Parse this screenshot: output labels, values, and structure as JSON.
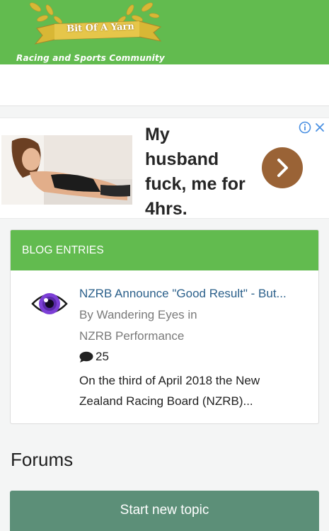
{
  "header": {
    "logo_text": "Bit Of A Yarn",
    "subtitle": "Racing and Sports Community",
    "colors": {
      "brand_green": "#62bb4f",
      "logo_gold": "#d8b735"
    }
  },
  "ad": {
    "headline_lines": [
      "My",
      "husband",
      "fuck, me for",
      "4hrs."
    ],
    "cta_icon": "chevron-right-icon",
    "info_icon": "info-icon",
    "close_icon": "close-icon",
    "colors": {
      "cta": "#9a6336",
      "adchoices": "#4a90e2"
    }
  },
  "blog": {
    "heading": "BLOG ENTRIES",
    "entries": [
      {
        "title": "NZRB Announce \"Good Result\" - But...",
        "byline": "By Wandering Eyes in",
        "category": "NZRB Performance",
        "comments": "25",
        "excerpt_lines": [
          "On the third of April 2018 the New",
          "Zealand Racing Board (NZRB)..."
        ],
        "avatar_icon": "eye-icon"
      }
    ]
  },
  "forums": {
    "heading": "Forums",
    "start_button": "Start new topic",
    "button_color": "#5c8f78"
  }
}
